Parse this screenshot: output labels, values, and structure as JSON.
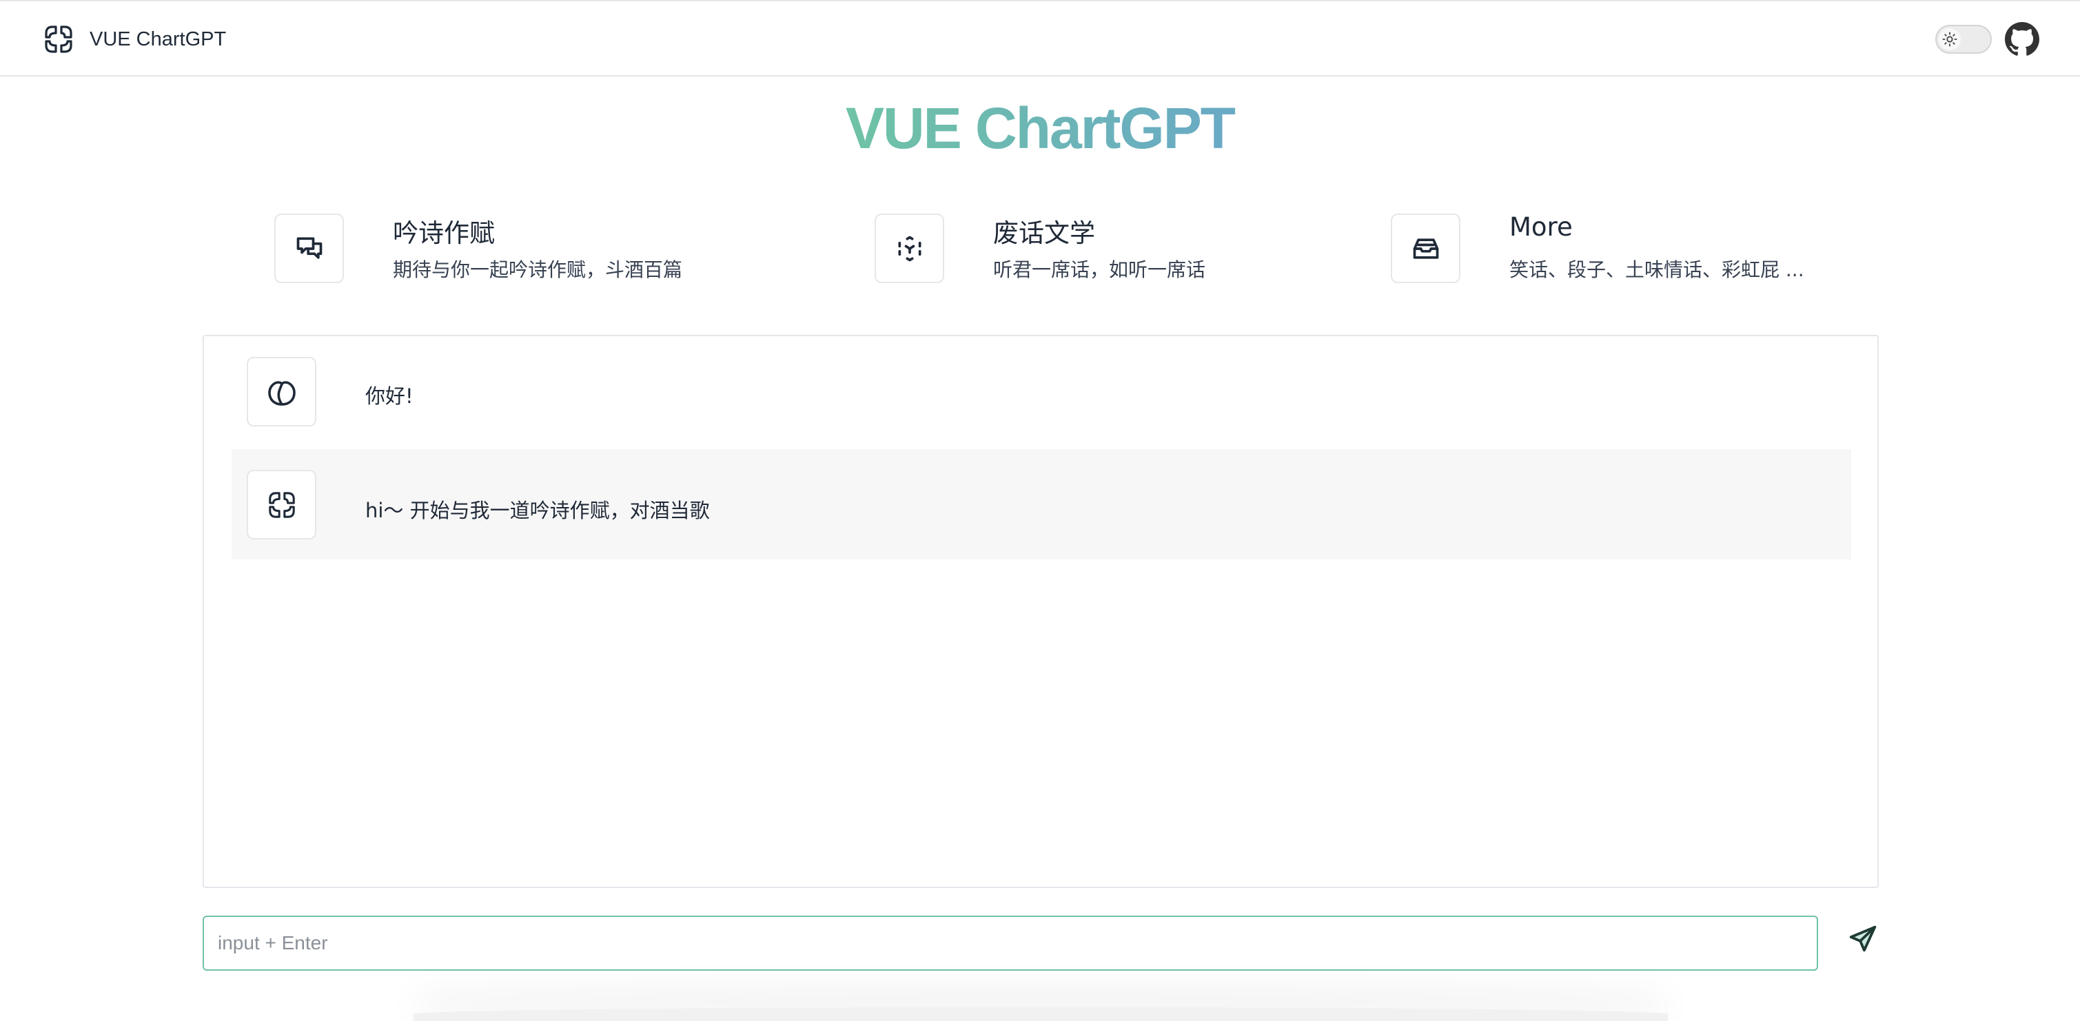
{
  "header": {
    "app_title": "VUE ChartGPT",
    "theme_toggle_icon": "sun-icon",
    "github_icon": "github-icon"
  },
  "hero": {
    "title": "VUE ChartGPT",
    "gradient_start": "#6fc3a5",
    "gradient_end": "#69a9c6"
  },
  "features": [
    {
      "icon": "chat-bubbles-icon",
      "title": "吟诗作赋",
      "description": "期待与你一起吟诗作赋，斗酒百篇"
    },
    {
      "icon": "scan-face-icon",
      "title": "废话文学",
      "description": "听君一席话，如听一席话"
    },
    {
      "icon": "inbox-icon",
      "title": "More",
      "description": "笑话、段子、土味情话、彩虹屁 ..."
    }
  ],
  "chat": {
    "messages": [
      {
        "role": "user",
        "avatar_icon": "leaf-avatar-icon",
        "text": "你好!"
      },
      {
        "role": "assistant",
        "avatar_icon": "app-logo-icon",
        "text": "hi～ 开始与我一道吟诗作赋，对酒当歌"
      }
    ]
  },
  "input": {
    "value": "",
    "placeholder": "input + Enter",
    "send_icon": "send-icon",
    "accent": "#6fc3a5"
  }
}
